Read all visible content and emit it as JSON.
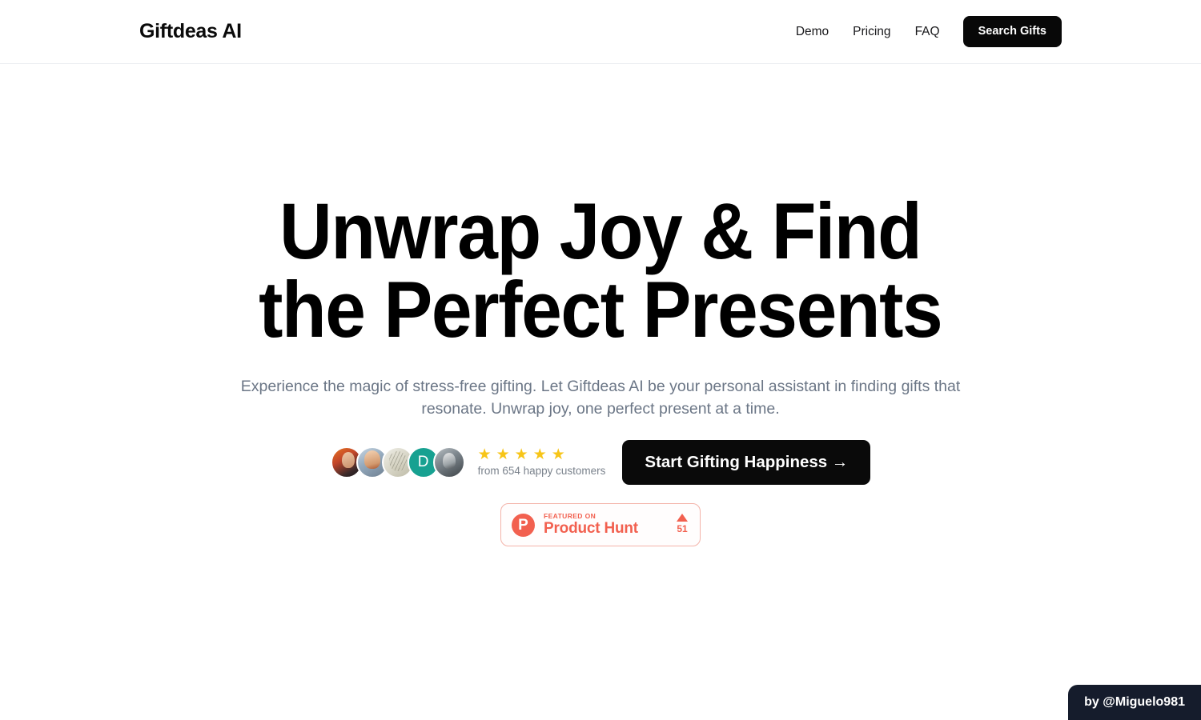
{
  "header": {
    "brand": "Giftdeas AI",
    "nav_links": [
      {
        "label": "Demo"
      },
      {
        "label": "Pricing"
      },
      {
        "label": "FAQ"
      }
    ],
    "cta_label": "Search Gifts"
  },
  "hero": {
    "headline_line1": "Unwrap Joy & Find",
    "headline_line2": "the Perfect Presents",
    "subtitle": "Experience the magic of stress-free gifting. Let Giftdeas AI be your personal assistant in finding gifts that resonate. Unwrap joy, one perfect present at a time.",
    "cta_label": "Start Gifting Happiness →",
    "social_proof": {
      "avatars": [
        {
          "name": "avatar-1",
          "type": "photo",
          "initial": ""
        },
        {
          "name": "avatar-2",
          "type": "photo",
          "initial": ""
        },
        {
          "name": "avatar-3",
          "type": "sketch",
          "initial": ""
        },
        {
          "name": "avatar-4",
          "type": "initial",
          "initial": "D",
          "color": "#17a191"
        },
        {
          "name": "avatar-5",
          "type": "photo",
          "initial": ""
        }
      ],
      "star_glyph": "★",
      "star_count": 5,
      "star_color": "#f7c518",
      "caption": "from 654 happy customers"
    }
  },
  "product_hunt_badge": {
    "logo_letter": "P",
    "featured_label": "FEATURED ON",
    "name": "Product Hunt",
    "upvotes": "51",
    "accent_color": "#f2604f"
  },
  "credit_badge": {
    "label": "by @Miguelo981"
  }
}
